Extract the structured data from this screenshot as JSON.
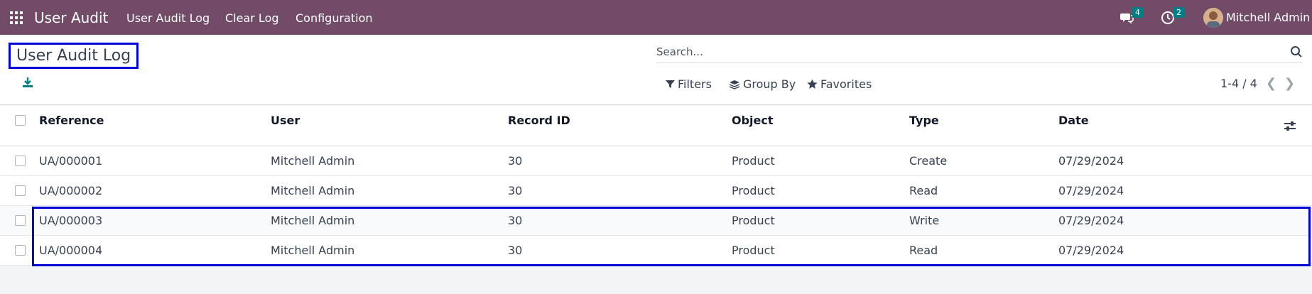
{
  "navbar": {
    "brand": "User Audit",
    "menu": [
      "User Audit Log",
      "Clear Log",
      "Configuration"
    ],
    "messages_count": "4",
    "activities_count": "2",
    "user_name": "Mitchell Admin"
  },
  "control_panel": {
    "title": "User Audit Log",
    "search_placeholder": "Search...",
    "filters_label": "Filters",
    "group_by_label": "Group By",
    "favorites_label": "Favorites",
    "pager_text": "1-4 / 4"
  },
  "table": {
    "headers": {
      "reference": "Reference",
      "user": "User",
      "record_id": "Record ID",
      "object": "Object",
      "type": "Type",
      "date": "Date"
    },
    "rows": [
      {
        "reference": "UA/000001",
        "user": "Mitchell Admin",
        "record_id": "30",
        "object": "Product",
        "type": "Create",
        "date": "07/29/2024"
      },
      {
        "reference": "UA/000002",
        "user": "Mitchell Admin",
        "record_id": "30",
        "object": "Product",
        "type": "Read",
        "date": "07/29/2024"
      },
      {
        "reference": "UA/000003",
        "user": "Mitchell Admin",
        "record_id": "30",
        "object": "Product",
        "type": "Write",
        "date": "07/29/2024"
      },
      {
        "reference": "UA/000004",
        "user": "Mitchell Admin",
        "record_id": "30",
        "object": "Product",
        "type": "Read",
        "date": "07/29/2024"
      }
    ]
  },
  "colors": {
    "navbar_bg": "#714b67",
    "badge_bg": "#017e84",
    "highlight_border": "#0000d8"
  }
}
